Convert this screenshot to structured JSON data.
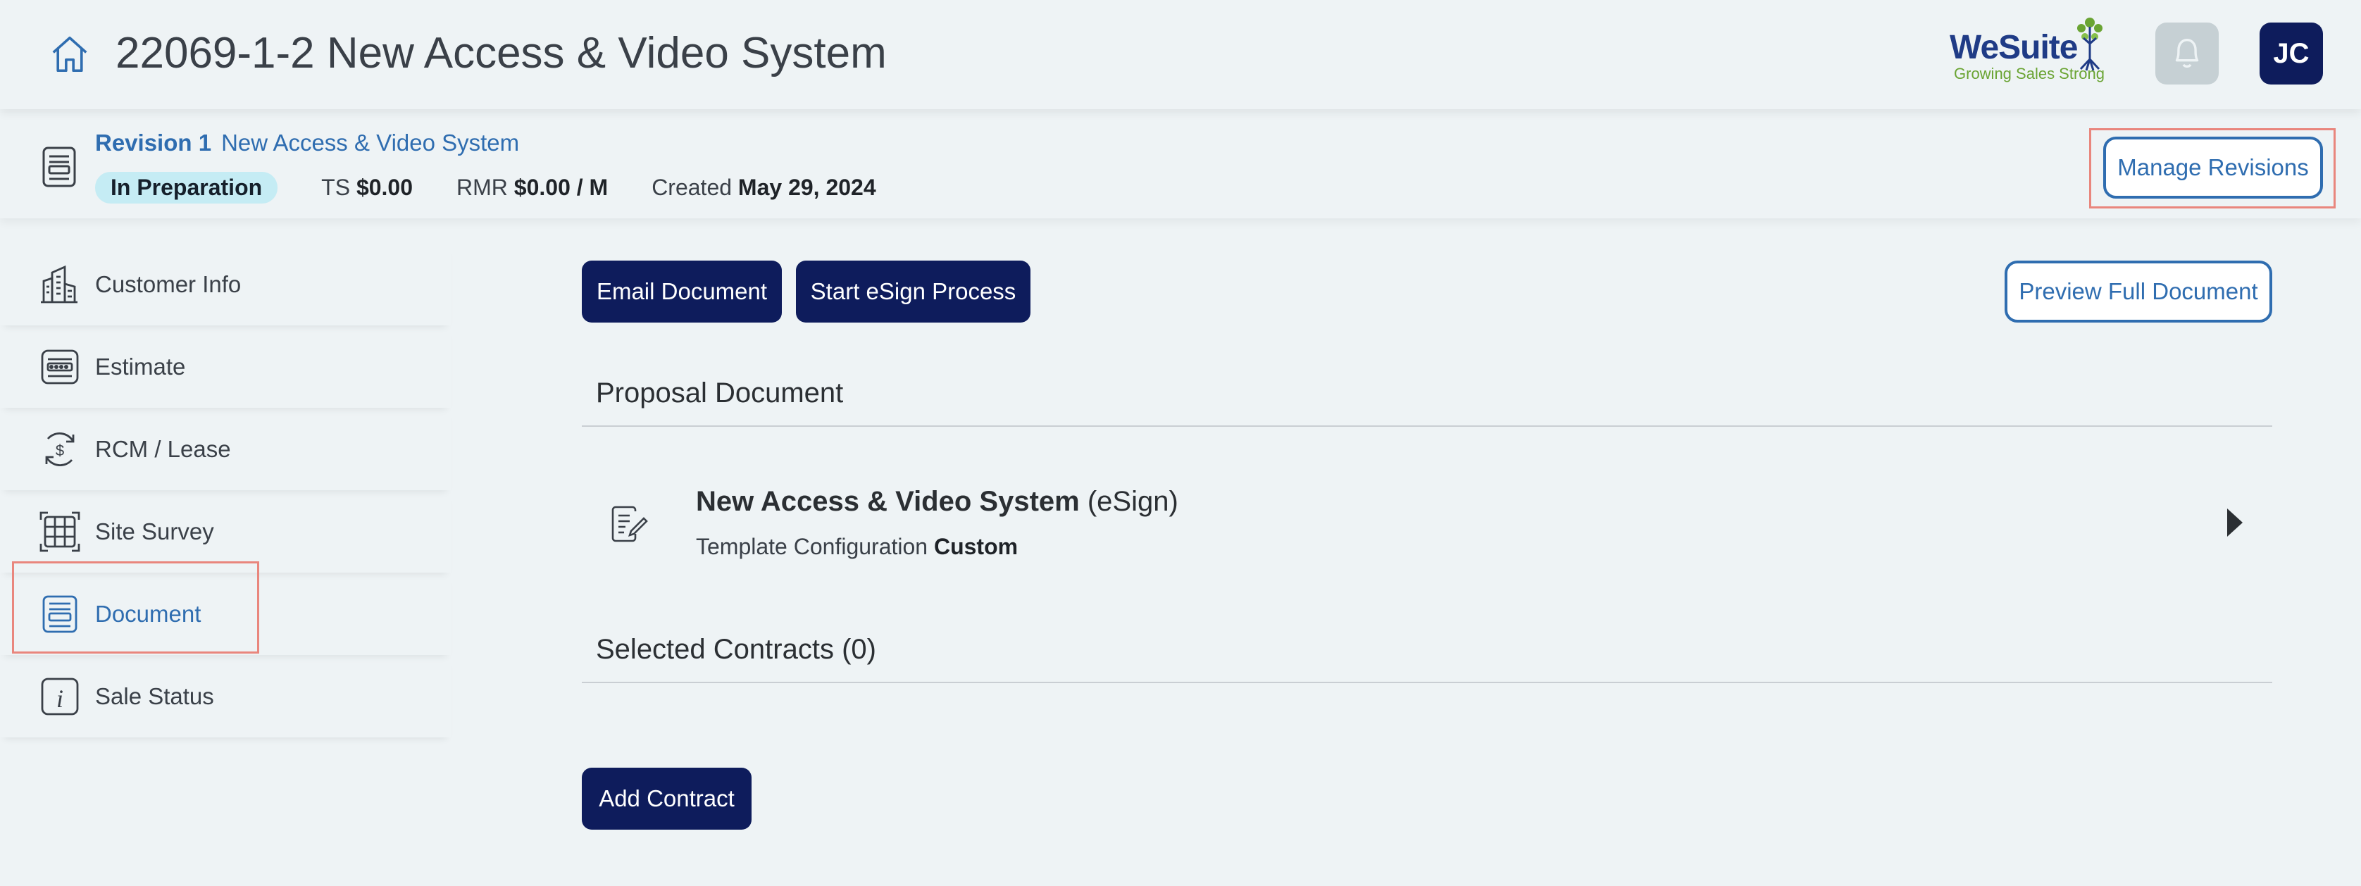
{
  "header": {
    "title": "22069-1-2 New Access & Video System",
    "logo_word": "WeSuite",
    "logo_tagline": "Growing Sales Strong",
    "avatar_initials": "JC",
    "brand_color": "#0e1c5c",
    "accent_color": "#2f6db0"
  },
  "revision": {
    "label": "Revision 1",
    "name": "New Access & Video System",
    "status": "In Preparation",
    "ts_label": "TS",
    "ts_value": "$0.00",
    "rmr_label": "RMR",
    "rmr_value": "$0.00 / M",
    "created_label": "Created",
    "created_value": "May 29, 2024",
    "manage_button": "Manage Revisions"
  },
  "sidebar": {
    "items": [
      {
        "label": "Customer Info",
        "icon": "building-icon"
      },
      {
        "label": "Estimate",
        "icon": "calculator-icon"
      },
      {
        "label": "RCM / Lease",
        "icon": "recurring-dollar-icon"
      },
      {
        "label": "Site Survey",
        "icon": "grid-survey-icon"
      },
      {
        "label": "Document",
        "icon": "document-icon",
        "active": true
      },
      {
        "label": "Sale Status",
        "icon": "info-icon"
      }
    ]
  },
  "toolbar": {
    "email_label": "Email Document",
    "esign_label": "Start eSign Process",
    "preview_label": "Preview Full Document"
  },
  "proposal": {
    "section_title": "Proposal Document",
    "doc_name": "New Access & Video System",
    "doc_kind": "(eSign)",
    "config_label": "Template Configuration",
    "config_value": "Custom"
  },
  "contracts": {
    "section_title": "Selected Contracts (0)",
    "add_label": "Add Contract"
  }
}
